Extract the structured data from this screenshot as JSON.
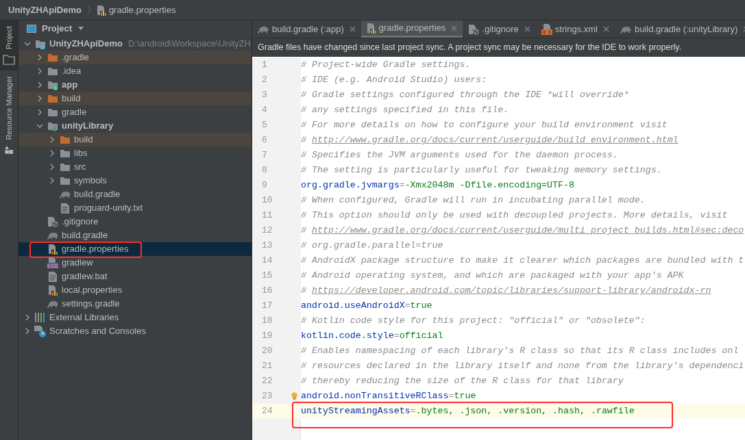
{
  "breadcrumb": [
    {
      "label": "UnityZHApiDemo"
    },
    {
      "label": "gradle.properties"
    }
  ],
  "tool_strip": [
    {
      "label": "Project",
      "selected": true,
      "kind": "project"
    },
    {
      "label": "Resource Manager",
      "selected": false,
      "kind": "resources"
    }
  ],
  "project_panel": {
    "title": "Project",
    "tree": [
      {
        "label": "UnityZHApiDemo",
        "path": "D:\\android\\Workspace\\UnityZH",
        "kind": "project",
        "bold": true,
        "expanded": true,
        "selected": false,
        "children": [
          {
            "label": ".gradle",
            "kind": "folder",
            "bold": false,
            "expanded": false,
            "excluded": true,
            "selected": false
          },
          {
            "label": ".idea",
            "kind": "folder",
            "bold": false,
            "expanded": false,
            "excluded": false,
            "selected": false
          },
          {
            "label": "app",
            "kind": "module-app",
            "bold": true,
            "expanded": false,
            "selected": false
          },
          {
            "label": "build",
            "kind": "folder",
            "bold": false,
            "expanded": false,
            "excluded": true,
            "selected": false
          },
          {
            "label": "gradle",
            "kind": "folder",
            "bold": false,
            "expanded": false,
            "excluded": false,
            "selected": false
          },
          {
            "label": "unityLibrary",
            "kind": "module-lib",
            "bold": true,
            "expanded": true,
            "selected": false,
            "children": [
              {
                "label": "build",
                "kind": "folder",
                "bold": false,
                "expanded": false,
                "excluded": true,
                "selected": false
              },
              {
                "label": "libs",
                "kind": "folder",
                "bold": false,
                "expanded": false,
                "excluded": false,
                "selected": false
              },
              {
                "label": "src",
                "kind": "folder",
                "bold": false,
                "expanded": false,
                "excluded": false,
                "selected": false
              },
              {
                "label": "symbols",
                "kind": "folder",
                "bold": false,
                "expanded": false,
                "excluded": false,
                "selected": false
              },
              {
                "label": "build.gradle",
                "kind": "gradle",
                "bold": false,
                "selected": false
              },
              {
                "label": "proguard-unity.txt",
                "kind": "text",
                "bold": false,
                "selected": false
              }
            ]
          },
          {
            "label": ".gitignore",
            "kind": "ignore",
            "bold": false,
            "selected": false
          },
          {
            "label": "build.gradle",
            "kind": "gradle",
            "bold": false,
            "selected": false
          },
          {
            "label": "gradle.properties",
            "kind": "properties",
            "bold": false,
            "selected": true,
            "annotated": true
          },
          {
            "label": "gradlew",
            "kind": "script",
            "bold": false,
            "selected": false
          },
          {
            "label": "gradlew.bat",
            "kind": "text",
            "bold": false,
            "selected": false
          },
          {
            "label": "local.properties",
            "kind": "properties",
            "bold": false,
            "selected": false
          },
          {
            "label": "settings.gradle",
            "kind": "gradle",
            "bold": false,
            "selected": false
          }
        ]
      },
      {
        "label": "External Libraries",
        "kind": "libraries",
        "bold": false,
        "expanded": false,
        "selected": false
      },
      {
        "label": "Scratches and Consoles",
        "kind": "scratches",
        "bold": false,
        "expanded": false,
        "selected": false
      }
    ]
  },
  "tabs": [
    {
      "label": "build.gradle (:app)",
      "kind": "gradle",
      "selected": false
    },
    {
      "label": "gradle.properties",
      "kind": "properties",
      "selected": true
    },
    {
      "label": ".gitignore",
      "kind": "ignore",
      "selected": false
    },
    {
      "label": "strings.xml",
      "kind": "xml",
      "selected": false
    },
    {
      "label": "build.gradle (:unityLibrary)",
      "kind": "gradle",
      "selected": false
    }
  ],
  "notification": "Gradle files have changed since last project sync. A project sync may be necessary for the IDE to work properly.",
  "editor": {
    "lines": [
      {
        "number": "1",
        "kind": "comment",
        "text": "# Project-wide Gradle settings.",
        "selected": false
      },
      {
        "number": "2",
        "kind": "comment",
        "text": "# IDE (e.g. Android Studio) users:",
        "selected": false
      },
      {
        "number": "3",
        "kind": "comment",
        "text": "# Gradle settings configured through the IDE *will override*",
        "selected": false
      },
      {
        "number": "4",
        "kind": "comment",
        "text": "# any settings specified in this file.",
        "selected": false
      },
      {
        "number": "5",
        "kind": "comment",
        "text": "# For more details on how to configure your build environment visit",
        "selected": false
      },
      {
        "number": "6",
        "kind": "link",
        "prefix": "# ",
        "url": "http://www.gradle.org/docs/current/userguide/build_environment.html",
        "selected": false
      },
      {
        "number": "7",
        "kind": "comment",
        "text": "# Specifies the JVM arguments used for the daemon process.",
        "selected": false
      },
      {
        "number": "8",
        "kind": "comment",
        "text": "# The setting is particularly useful for tweaking memory settings.",
        "selected": false
      },
      {
        "number": "9",
        "kind": "property",
        "key": "org.gradle.jvmargs",
        "sep": "=",
        "value": "-Xmx2048m -Dfile.encoding=UTF-8",
        "selected": false
      },
      {
        "number": "10",
        "kind": "comment",
        "text": "# When configured, Gradle will run in incubating parallel mode.",
        "selected": false
      },
      {
        "number": "11",
        "kind": "comment",
        "text": "# This option should only be used with decoupled projects. More details, visit",
        "selected": false
      },
      {
        "number": "12",
        "kind": "link",
        "prefix": "# ",
        "url": "http://www.gradle.org/docs/current/userguide/multi_project_builds.html#sec:deco",
        "selected": false
      },
      {
        "number": "13",
        "kind": "comment",
        "text": "# org.gradle.parallel=true",
        "selected": false
      },
      {
        "number": "14",
        "kind": "comment",
        "text": "# AndroidX package structure to make it clearer which packages are bundled with t",
        "selected": false
      },
      {
        "number": "15",
        "kind": "comment",
        "text": "# Android operating system, and which are packaged with your app's APK",
        "selected": false
      },
      {
        "number": "16",
        "kind": "link",
        "prefix": "# ",
        "url": "https://developer.android.com/topic/libraries/support-library/androidx-rn",
        "selected": false
      },
      {
        "number": "17",
        "kind": "property",
        "key": "android.useAndroidX",
        "sep": "=",
        "value": "true",
        "selected": false
      },
      {
        "number": "18",
        "kind": "comment",
        "text": "# Kotlin code style for this project: \"official\" or \"obsolete\":",
        "selected": false
      },
      {
        "number": "19",
        "kind": "property",
        "key": "kotlin.code.style",
        "sep": "=",
        "value": "official",
        "selected": false
      },
      {
        "number": "20",
        "kind": "comment",
        "text": "# Enables namespacing of each library's R class so that its R class includes onl",
        "selected": false
      },
      {
        "number": "21",
        "kind": "comment",
        "text": "# resources declared in the library itself and none from the library's dependenci",
        "selected": false
      },
      {
        "number": "22",
        "kind": "comment",
        "text": "# thereby reducing the size of the R class for that library",
        "selected": false
      },
      {
        "number": "23",
        "kind": "property",
        "key": "android.nonTransitiveRClass",
        "sep": "=",
        "value": "true",
        "selected": false,
        "bulb": true
      },
      {
        "number": "24",
        "kind": "property",
        "key": "unityStreamingAssets",
        "sep": "=",
        "value": ".bytes, .json, .version, .hash, .rawfile",
        "selected": true,
        "annotated": true
      }
    ]
  }
}
